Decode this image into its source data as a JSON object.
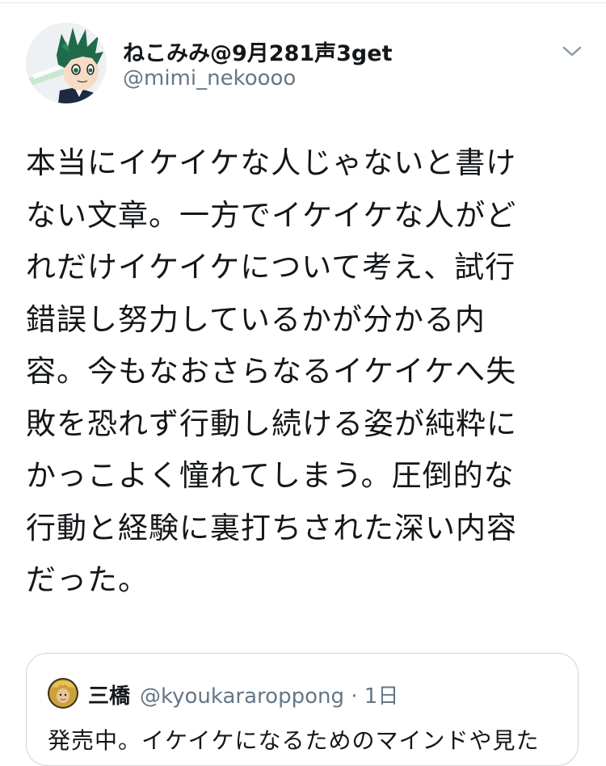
{
  "tweet": {
    "author": {
      "name": "ねこみみ@9月281声3get",
      "handle": "@mimi_nekoooo",
      "avatar_icon": "anime-boy-avatar-icon"
    },
    "menu_icon": "chevron-down-icon",
    "text_lines": [
      "本当にイケイケな人じゃないと書け",
      "ない文章。一方でイケイケな人がど",
      "れだけイケイケについて考え、試行",
      "錯誤し努力しているかが分かる内",
      "容。今もなおさらなるイケイケへ失",
      "敗を恐れず行動し続ける姿が純粋に",
      "かっこよく憧れてしまう。圧倒的な",
      "行動と経験に裏打ちされた深い内容",
      "だった。"
    ]
  },
  "quoted_tweet": {
    "name": "三橋",
    "handle_time": "@kyoukararoppong · 1日",
    "avatar_icon": "golden-hair-avatar-icon",
    "text": "発売中。イケイケになるためのマインドや見た"
  },
  "colors": {
    "text": "#14171a",
    "secondary": "#657786",
    "border": "#ccd6dd",
    "divider": "#e1e8ed"
  }
}
